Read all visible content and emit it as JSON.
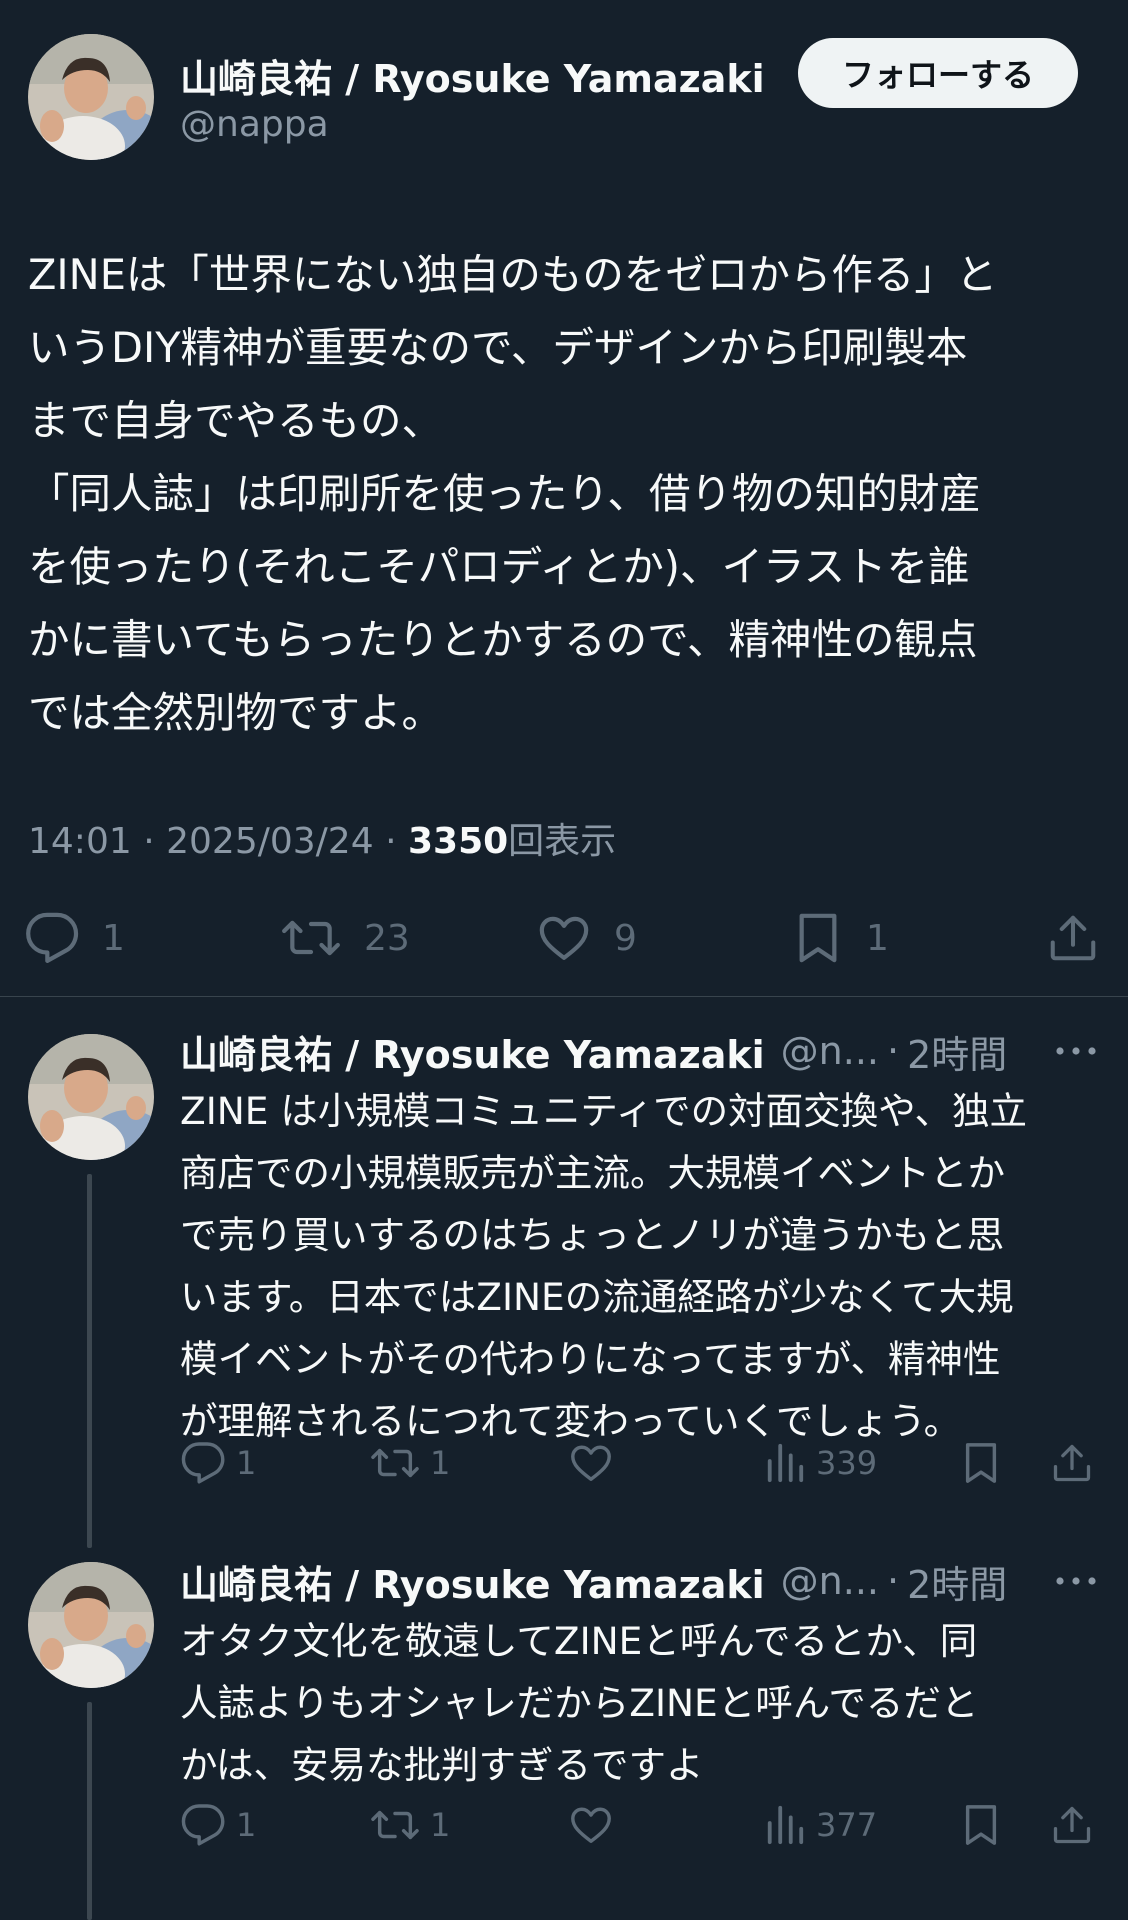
{
  "main_tweet": {
    "author_name": "山崎良祐 / Ryosuke Yamazaki",
    "handle": "@nappa",
    "follow_label": "フォローする",
    "body": "ZINEは「世界にない独自のものをゼロから作る」と\nいうDIY精神が重要なので、デザインから印刷製本\nまで自身でやるもの、\n「同人誌」は印刷所を使ったり、借り物の知的財産\nを使ったり(それこそパロディとか)、イラストを誰\nかに書いてもらったりとかするので、精神性の観点\nでは全然別物ですよ。",
    "time": "14:01",
    "date": "2025/03/24",
    "views_count": "3350",
    "views_label": "回表示",
    "meta_sep": "·",
    "replies": "1",
    "retweets": "23",
    "likes": "9",
    "bookmarks": "1"
  },
  "replies": [
    {
      "author_name": "山崎良祐 / Ryosuke Yamazaki",
      "handle": "@n...",
      "sep": "·",
      "time": "2時間",
      "body": "ZINE は小規模コミュニティでの対面交換や、独立\n商店での小規模販売が主流。大規模イベントとか\nで売り買いするのはちょっとノリが違うかもと思\nいます。日本ではZINEの流通経路が少なくて大規\n模イベントがその代わりになってますが、精神性\nが理解されるにつれて変わっていくでしょう。",
      "replies": "1",
      "retweets": "1",
      "views": "339"
    },
    {
      "author_name": "山崎良祐 / Ryosuke Yamazaki",
      "handle": "@n...",
      "sep": "·",
      "time": "2時間",
      "body": "オタク文化を敬遠してZINEと呼んでるとか、同\n人誌よりもオシャレだからZINEと呼んでるだと\nかは、安易な批判すぎるですよ",
      "replies": "1",
      "retweets": "1",
      "views": "377"
    }
  ],
  "icons": {
    "avatar": "profile-photo",
    "reply": "reply-icon",
    "retweet": "retweet-icon",
    "like": "heart-icon",
    "bookmark": "bookmark-icon",
    "share": "share-icon",
    "views": "analytics-icon",
    "more": "more-icon"
  }
}
